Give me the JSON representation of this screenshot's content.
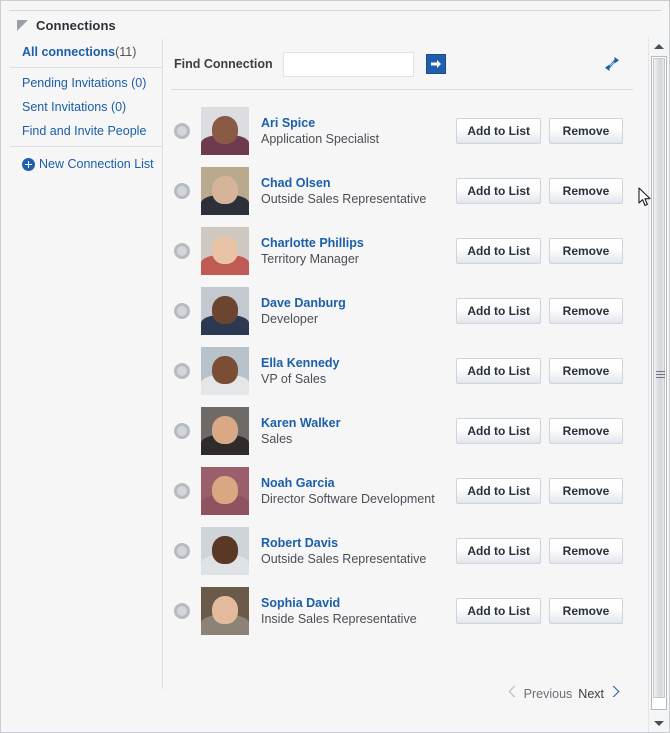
{
  "header": {
    "title": "Connections",
    "disclosure_icon": "triangle-collapse-icon"
  },
  "sidebar": {
    "items": [
      {
        "label": "All connections",
        "count": "(11)",
        "name": "all-connections"
      },
      {
        "label": "Pending Invitations (0)",
        "name": "pending-invitations"
      },
      {
        "label": "Sent Invitations (0)",
        "name": "sent-invitations"
      },
      {
        "label": "Find and Invite People",
        "name": "find-and-invite-people"
      }
    ],
    "new_list": {
      "label": "New Connection List",
      "icon": "plus-circle-icon"
    }
  },
  "toolbar": {
    "find_label": "Find Connection",
    "search_value": "",
    "search_placeholder": "",
    "go_icon": "arrow-right-icon",
    "refresh_icon": "refresh-swap-icon"
  },
  "list": {
    "action_add_label": "Add to List",
    "action_remove_label": "Remove",
    "presence_icon": "presence-circle-icon",
    "connections": [
      {
        "name": "Ari Spice",
        "title": "Application Specialist",
        "avatar_skin": "#8a5a45",
        "avatar_shirt": "#6e3a4e",
        "avatar_bg": "#dcdde0"
      },
      {
        "name": "Chad Olsen",
        "title": "Outside Sales Representative",
        "avatar_skin": "#d6b49a",
        "avatar_shirt": "#2c3038",
        "avatar_bg": "#b9a98f"
      },
      {
        "name": "Charlotte Phillips",
        "title": "Territory Manager",
        "avatar_skin": "#e8c3a6",
        "avatar_shirt": "#c05a55",
        "avatar_bg": "#cfc8c0"
      },
      {
        "name": "Dave Danburg",
        "title": "Developer",
        "avatar_skin": "#6b4530",
        "avatar_shirt": "#2b3a52",
        "avatar_bg": "#c3c9cf"
      },
      {
        "name": "Ella Kennedy",
        "title": "VP of Sales",
        "avatar_skin": "#7a4e35",
        "avatar_shirt": "#e4e6e8",
        "avatar_bg": "#b7c2cb"
      },
      {
        "name": "Karen Walker",
        "title": "Sales",
        "avatar_skin": "#d9a884",
        "avatar_shirt": "#2e2b2a",
        "avatar_bg": "#6d6a68"
      },
      {
        "name": "Noah Garcia",
        "title": "Director Software Development",
        "avatar_skin": "#d8a882",
        "avatar_shirt": "#8e5260",
        "avatar_bg": "#9a5f6b"
      },
      {
        "name": "Robert Davis",
        "title": "Outside Sales Representative",
        "avatar_skin": "#5a3826",
        "avatar_shirt": "#dfe3e6",
        "avatar_bg": "#cfd4d8"
      },
      {
        "name": "Sophia David",
        "title": "Inside Sales Representative",
        "avatar_skin": "#e3bb9c",
        "avatar_shirt": "#8c8278",
        "avatar_bg": "#6b5a4a"
      }
    ]
  },
  "pagination": {
    "previous_label": "Previous",
    "next_label": "Next",
    "previous_icon": "chevron-left-icon",
    "next_icon": "chevron-right-icon",
    "previous_enabled": false,
    "next_enabled": true
  },
  "scrollbar": {
    "up_icon": "scroll-up-arrow-icon",
    "down_icon": "scroll-down-arrow-icon",
    "thumb_name": "scrollbar-thumb"
  },
  "colors": {
    "link": "#1a5fa8",
    "accent": "#1f5fab",
    "panel_bg": "#f6f6f7",
    "border": "#dcdfe3"
  }
}
